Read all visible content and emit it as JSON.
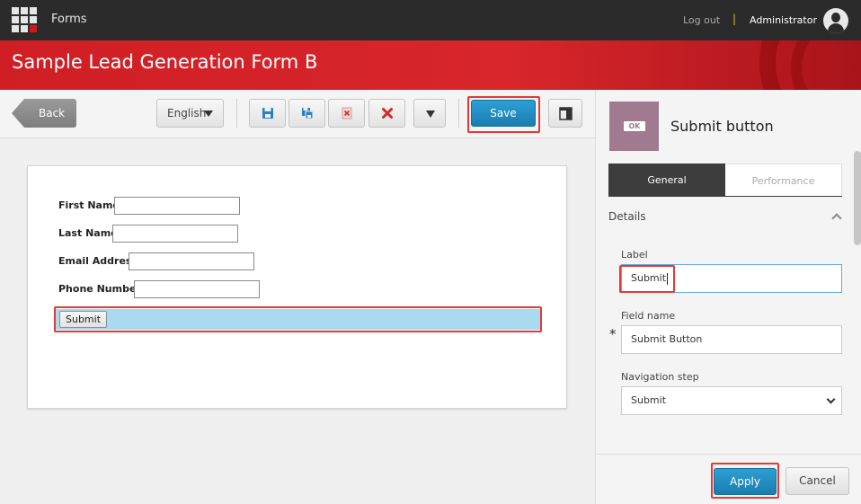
{
  "topbar": {
    "app_name": "Forms",
    "logout": "Log out",
    "separator": "|",
    "user": "Administrator"
  },
  "header": {
    "title": "Sample Lead Generation Form B"
  },
  "toolbar": {
    "back_label": "Back",
    "language": "English",
    "save_label": "Save",
    "icons": [
      "save-icon",
      "save-as-icon",
      "discard-icon",
      "delete-icon",
      "more-icon",
      "layout-icon"
    ]
  },
  "form": {
    "fields": [
      {
        "label": "First Name"
      },
      {
        "label": "Last Name"
      },
      {
        "label": "Email Address"
      },
      {
        "label": "Phone Number"
      }
    ],
    "submit_label": "Submit"
  },
  "panel": {
    "thumb_text": "OK",
    "title": "Submit button",
    "tabs": [
      {
        "label": "General",
        "active": true
      },
      {
        "label": "Performance",
        "active": false
      }
    ],
    "section": "Details",
    "label_field": {
      "label": "Label",
      "value": "Submit"
    },
    "fieldname_field": {
      "label": "Field name",
      "value": "Submit Button",
      "required_marker": "*"
    },
    "navstep_field": {
      "label": "Navigation step",
      "value": "Submit"
    },
    "apply_label": "Apply",
    "cancel_label": "Cancel"
  },
  "colors": {
    "accent_blue": "#1f8cc2",
    "header_red": "#d8262b",
    "highlight_red": "#e53935",
    "selection_blue": "#a9daf0"
  }
}
